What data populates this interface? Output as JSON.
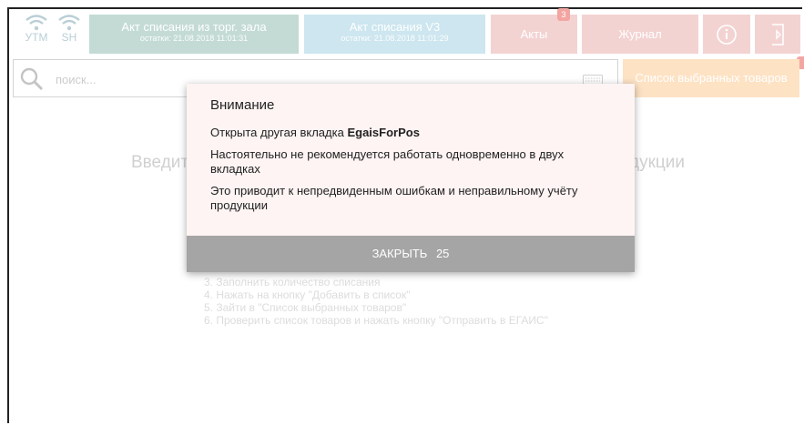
{
  "topbar": {
    "utm_label": "УТМ",
    "sh_label": "SH",
    "act_store": {
      "title": "Акт списания из торг. зала",
      "subtitle": "остатки: 21.08.2018 11:01:31"
    },
    "act_v3": {
      "title": "Акт списания V3",
      "subtitle": "остатки: 21.08.2018 11:01:29"
    },
    "acts": {
      "label": "Акты",
      "badge": "3"
    },
    "journal": {
      "label": "Журнал"
    },
    "info_icon": "info-icon",
    "exit_icon": "exit-icon"
  },
  "search": {
    "placeholder": "поиск..."
  },
  "selected_list": {
    "label": "Список выбранных товаров"
  },
  "background": {
    "hint_left": "Введит",
    "hint_right": "дукции",
    "steps": [
      "3. Заполнить количество списания",
      "4. Нажать на кнопку \"Добавить в список\"",
      "5. Зайти в \"Список выбранных товаров\"",
      "6. Проверить список товаров и нажать кнопку \"Отправить в ЕГАИС\""
    ]
  },
  "modal": {
    "title": "Внимание",
    "line1_prefix": "Открыта другая вкладка",
    "line1_tab": "EgaisForPos",
    "line2": "Настоятельно не рекомендуется работать одновременно в двух вкладках",
    "line3": "Это приводит к непредвиденным ошибкам и неправильному учёту продукции",
    "close_label": "ЗАКРЫТЬ",
    "countdown": "25"
  },
  "colors": {
    "green_btn": "#c4dbd5",
    "blue_btn": "#cde6ef",
    "pink_btn": "#f3d3d2",
    "orange_btn": "#fde2c4",
    "close_btn": "#a5a5a5",
    "modal_bg": "#fdf4f3"
  }
}
